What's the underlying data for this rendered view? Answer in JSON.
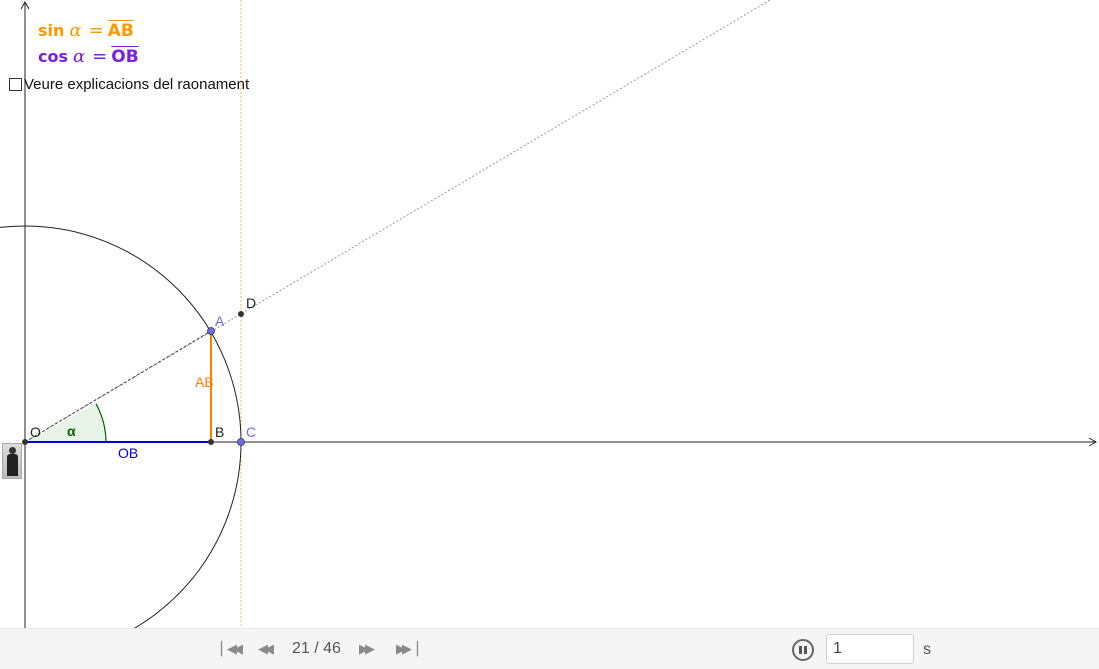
{
  "formulas": {
    "sin": {
      "fn": "sin",
      "var": "α",
      "eq": "=",
      "segment": "AB",
      "color": "#ff9900"
    },
    "cos": {
      "fn": "cos",
      "var": "α",
      "eq": "=",
      "segment": "OB",
      "color": "#7a1fe0"
    }
  },
  "checkbox": {
    "label": "Veure explicacions del raonament",
    "checked": false
  },
  "points": {
    "O": "O",
    "A": "A",
    "B": "B",
    "C": "C",
    "D": "D"
  },
  "segment_labels": {
    "AB": "AB",
    "OB": "OB"
  },
  "angle_label": "α",
  "colors": {
    "sin": "#ff9900",
    "cos": "#7a1fe0",
    "ob_segment": "#0000dd",
    "ab_segment": "#ff7f00",
    "angle_arc": "#006400",
    "free_point": "#6c6cf0"
  },
  "toolbar": {
    "step": "21 / 46",
    "speed": "1",
    "unit": "s",
    "first_icon": "skip-to-start-icon",
    "prev_icon": "rewind-icon",
    "next_icon": "fast-forward-icon",
    "last_icon": "skip-to-end-icon",
    "pause_icon": "pause-icon"
  }
}
